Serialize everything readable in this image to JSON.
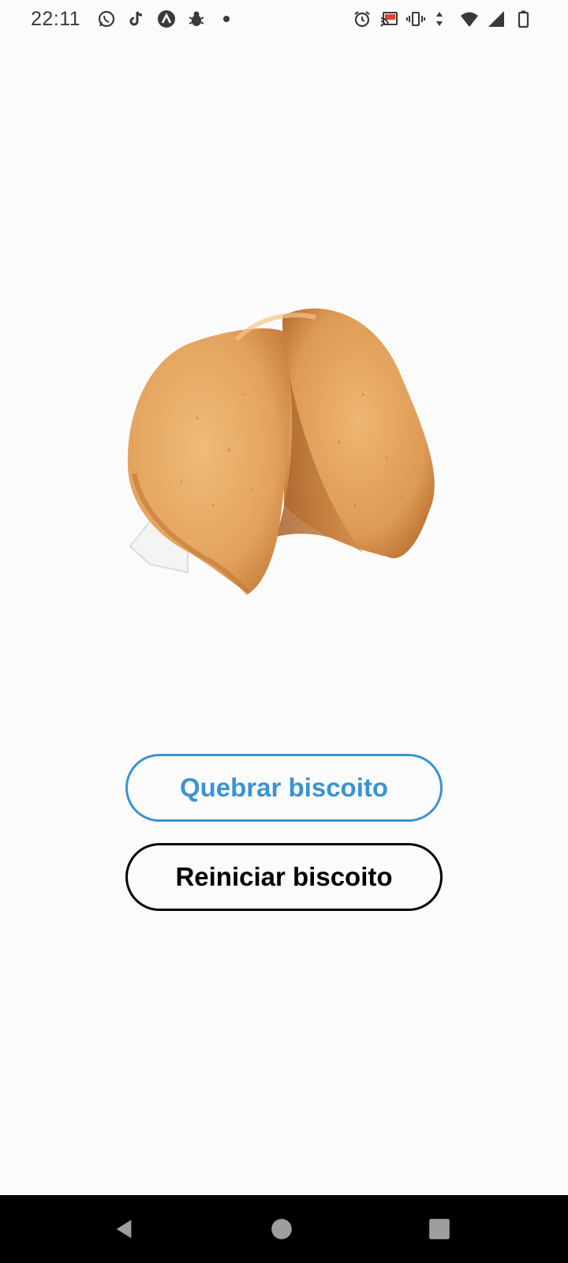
{
  "status_bar": {
    "time": "22:11",
    "left_icons": [
      "whatsapp-icon",
      "tiktok-icon",
      "app-a-icon",
      "bug-icon",
      "dot-icon"
    ],
    "right_icons": [
      "alarm-icon",
      "cast-icon",
      "vibrate-icon",
      "wifi-icon",
      "signal-icon",
      "battery-icon"
    ]
  },
  "main": {
    "image": "fortune-cookie"
  },
  "buttons": {
    "break_label": "Quebrar biscoito",
    "reset_label": "Reiniciar biscoito"
  },
  "colors": {
    "background": "#fbfbfb",
    "accent": "#3a93d2",
    "text": "#000000",
    "nav_bar": "#000000"
  },
  "nav_bar": {
    "buttons": [
      "back-icon",
      "home-icon",
      "recents-icon"
    ]
  }
}
